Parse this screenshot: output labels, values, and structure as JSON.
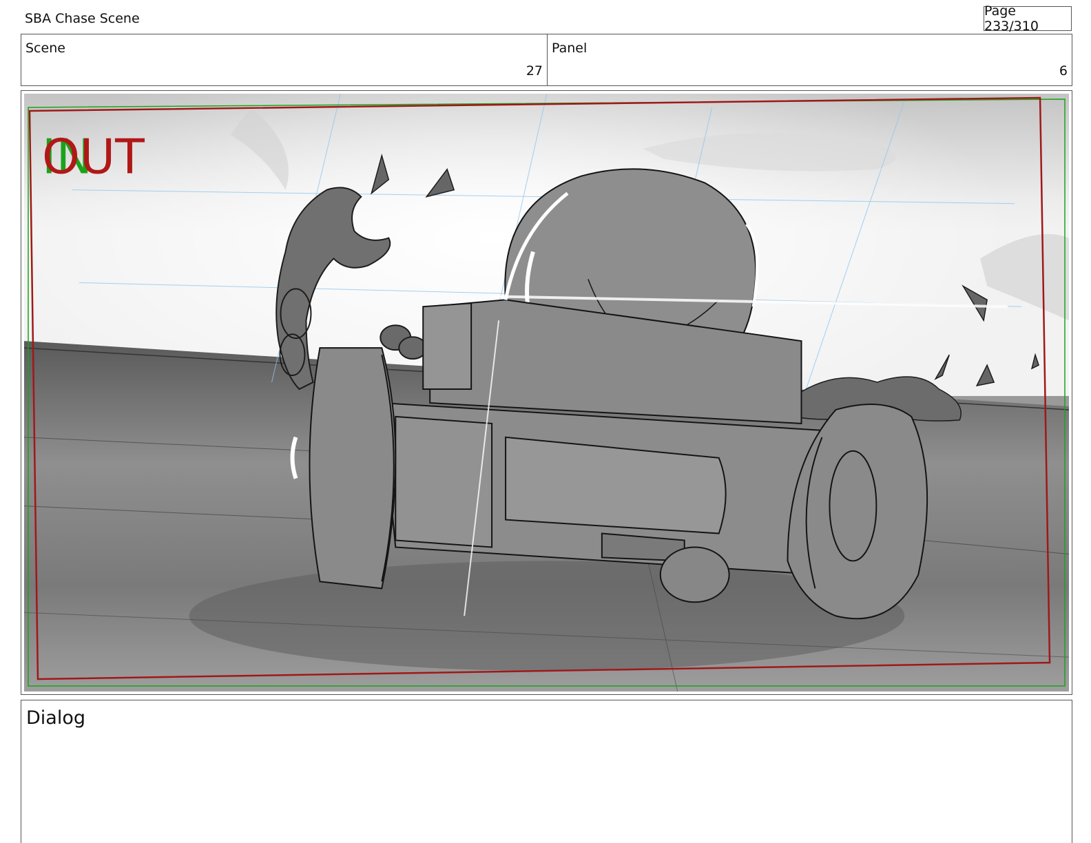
{
  "document": {
    "title": "SBA Chase Scene",
    "page": "Page 233/310"
  },
  "info": {
    "scene_label": "Scene",
    "scene_value": "27",
    "panel_label": "Panel",
    "panel_value": "6"
  },
  "panel_overlay": {
    "in_text": "IN",
    "out_text": "OUT",
    "in_color": "#1aa31a",
    "out_color": "#b01818"
  },
  "dialog": {
    "label": "Dialog",
    "text": ""
  }
}
